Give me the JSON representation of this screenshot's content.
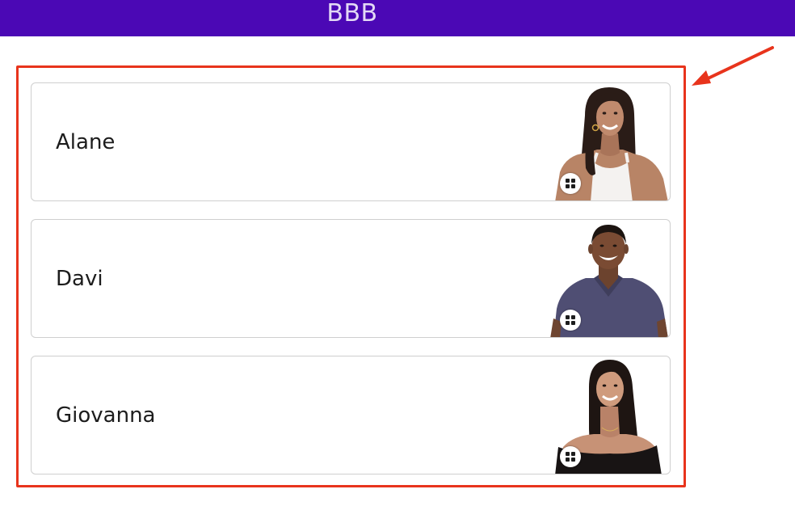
{
  "header": {
    "title": "BBB"
  },
  "participants": [
    {
      "name": "Alane",
      "photo": "participant-photo-woman-white-tank-top"
    },
    {
      "name": "Davi",
      "photo": "participant-photo-man-navy-polo"
    },
    {
      "name": "Giovanna",
      "photo": "participant-photo-woman-black-off-shoulder-top"
    }
  ],
  "annotation": {
    "highlight_color": "#e8341c",
    "arrow_icon": "arrow-pointing-left-icon"
  },
  "colors": {
    "header_bg": "#4b08b5",
    "header_text": "#e3d9f5",
    "card_border": "#cfcfcf"
  }
}
